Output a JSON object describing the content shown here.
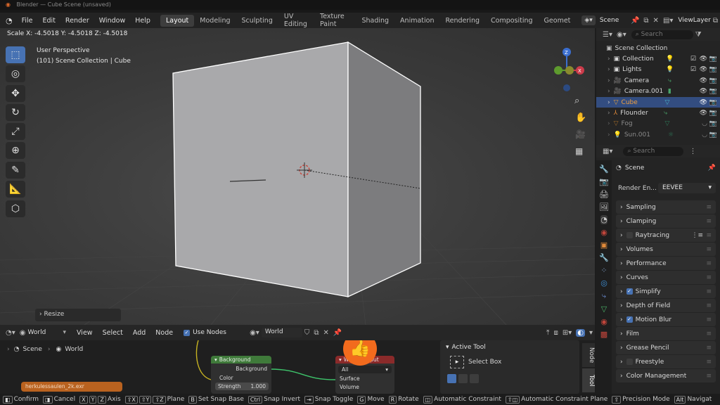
{
  "window": {
    "title": "Blender — Cube Scene (unsaved)"
  },
  "menu": {
    "file": "File",
    "edit": "Edit",
    "render": "Render",
    "window": "Window",
    "help": "Help"
  },
  "workspaces": [
    "Layout",
    "Modeling",
    "Sculpting",
    "UV Editing",
    "Texture Paint",
    "Shading",
    "Animation",
    "Rendering",
    "Compositing",
    "Geomet"
  ],
  "scene": {
    "name": "Scene",
    "view_layer": "ViewLayer"
  },
  "viewport": {
    "scale_readout": "Scale X: -4.5018  Y: -4.5018  Z: -4.5018",
    "perspective": "User Perspective",
    "context": "(101) Scene Collection | Cube",
    "resize_panel": "Resize"
  },
  "outliner": {
    "search_placeholder": "Search",
    "root": "Scene Collection",
    "items": [
      {
        "label": "Collection"
      },
      {
        "label": "Lights"
      },
      {
        "label": "Camera"
      },
      {
        "label": "Camera.001"
      },
      {
        "label": "Cube"
      },
      {
        "label": "Flounder"
      },
      {
        "label": "Fog"
      },
      {
        "label": "Sun.001"
      }
    ]
  },
  "properties": {
    "search_placeholder": "Search",
    "title": "Scene",
    "render_engine_label": "Render En...",
    "render_engine_value": "EEVEE",
    "panels": [
      {
        "label": "Sampling"
      },
      {
        "label": "Clamping"
      },
      {
        "label": "Raytracing"
      },
      {
        "label": "Volumes"
      },
      {
        "label": "Performance"
      },
      {
        "label": "Curves"
      },
      {
        "label": "Simplify"
      },
      {
        "label": "Depth of Field"
      },
      {
        "label": "Motion Blur"
      },
      {
        "label": "Film"
      },
      {
        "label": "Grease Pencil"
      },
      {
        "label": "Freestyle"
      },
      {
        "label": "Color Management"
      }
    ]
  },
  "node_editor": {
    "world_selector": "World",
    "view": "View",
    "select": "Select",
    "add": "Add",
    "node": "Node",
    "use_nodes": "Use Nodes",
    "world_name": "World",
    "breadcrumb_scene": "Scene",
    "breadcrumb_world": "World",
    "image_node": "herkulessaulen_2k.exr",
    "bg_node": {
      "title": "Background",
      "output": "Background",
      "color": "Color",
      "strength_label": "Strength",
      "strength_value": "1.000"
    },
    "wo_node": {
      "title": "World Output",
      "target": "All",
      "surface": "Surface",
      "volume": "Volume"
    },
    "active_tool": {
      "title": "Active Tool",
      "tool": "Select Box"
    },
    "side_tabs": {
      "node": "Node",
      "tool": "Tool"
    }
  },
  "status": {
    "confirm": "Confirm",
    "cancel": "Cancel",
    "axis": "Axis",
    "plane": "Plane",
    "snap_base": "Set Snap Base",
    "snap_invert": "Snap Invert",
    "snap_toggle": "Snap Toggle",
    "move": "Move",
    "rotate": "Rotate",
    "auto_constraint": "Automatic Constraint",
    "auto_constraint_plane": "Automatic Constraint Plane",
    "precision": "Precision Mode",
    "navigate": "Navigat"
  },
  "colors": {
    "accent": "#4772b3",
    "selection": "#334d80",
    "node_green": "#3f7a3a",
    "node_red": "#8a2a2a",
    "node_orange": "#c0652a",
    "like_orange": "#f26b1d"
  }
}
